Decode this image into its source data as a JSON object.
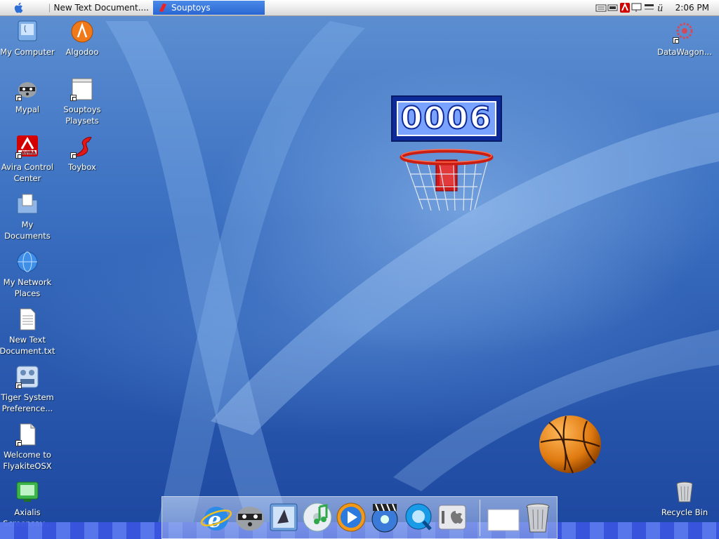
{
  "menubar": {
    "tasks": [
      {
        "label": "New Text Document...."
      },
      {
        "label": "Souptoys"
      }
    ],
    "time": "2:06 PM",
    "tray_icons": [
      "keyboard-icon",
      "battery-icon",
      "avira-icon",
      "monitor-icon",
      "network-icon",
      "user-icon"
    ]
  },
  "desktop": {
    "icons": [
      {
        "label": "My Computer"
      },
      {
        "label": "Algodoo"
      },
      {
        "label": "Mypal"
      },
      {
        "label": "Souptoys\nPlaysets"
      },
      {
        "label": "Avira Control\nCenter"
      },
      {
        "label": "Toybox"
      },
      {
        "label": "My\nDocuments"
      },
      {
        "label": "My Network\nPlaces"
      },
      {
        "label": "New Text\nDocument.txt"
      },
      {
        "label": "Tiger System\nPreference..."
      },
      {
        "label": "Welcome to\nFlyakiteOSX"
      },
      {
        "label": "Axialis\nScreensav..."
      },
      {
        "label": "DataWagon..."
      },
      {
        "label": "Recycle Bin"
      }
    ]
  },
  "scoreboard": {
    "value": "0006"
  },
  "dock": {
    "items": [
      "internet-explorer-icon",
      "mypal-icon",
      "mail-icon",
      "itunes-icon",
      "media-player-icon",
      "dvd-player-icon",
      "quicktime-icon",
      "system-preferences-icon",
      "window-icon",
      "trash-icon"
    ]
  },
  "colors": {
    "desktop": "#2b5bb0",
    "active_task": "#2a66d2",
    "scoreboard": "#0d2a9a"
  }
}
